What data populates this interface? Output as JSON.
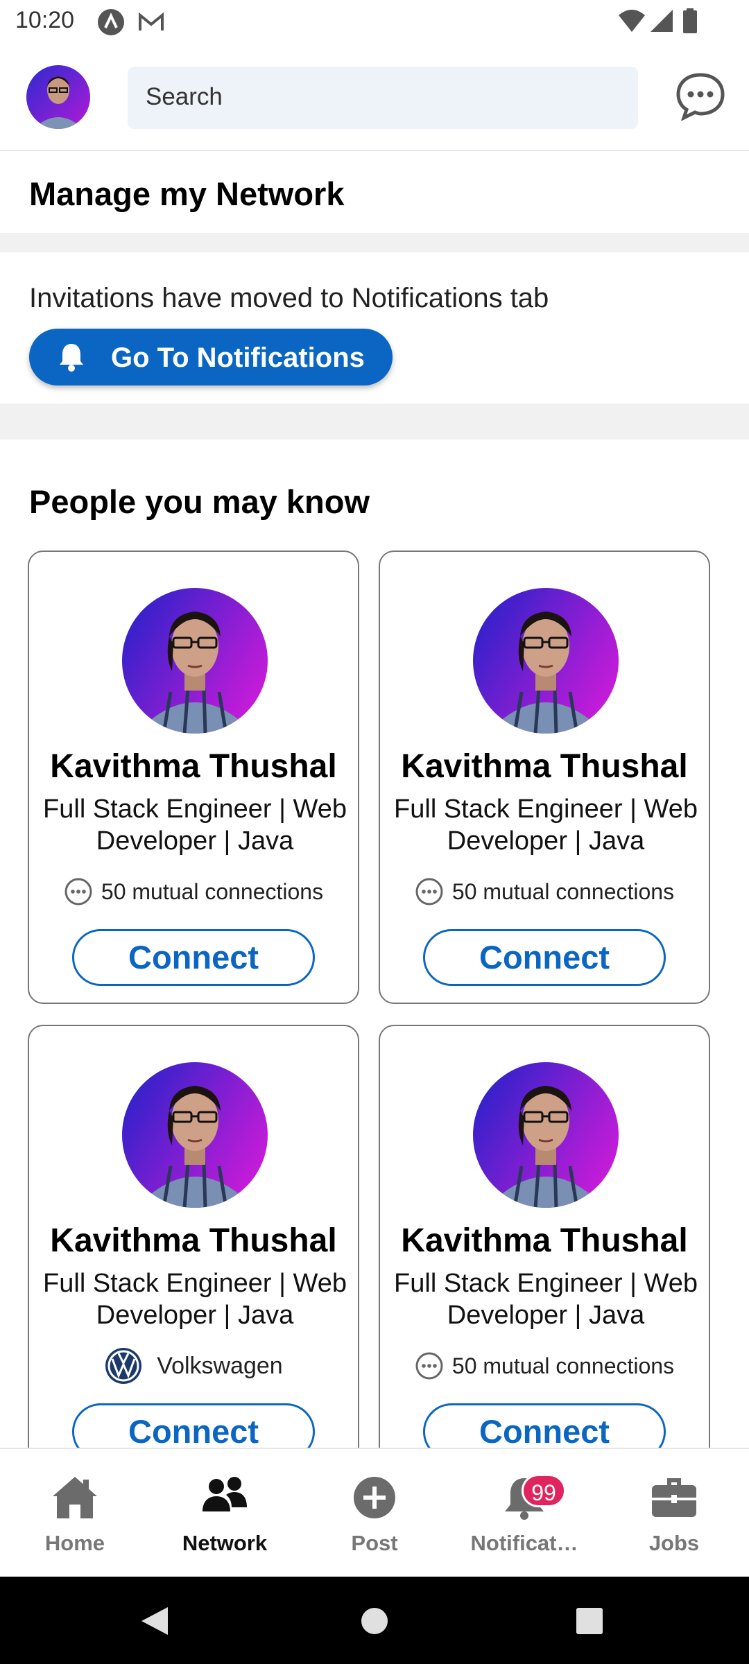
{
  "status_bar": {
    "time": "10:20"
  },
  "header": {
    "search_placeholder": "Search"
  },
  "manage": {
    "title": "Manage my Network"
  },
  "invitations": {
    "message": "Invitations have moved to Notifications tab",
    "button_label": "Go To Notifications"
  },
  "people": {
    "title": "People you may know",
    "cards": [
      {
        "name": "Kavithma Thushal",
        "headline": "Full Stack Engineer | Web Developer | Java",
        "meta": "50 mutual connections",
        "meta_icon": "mutual-connections-icon",
        "button": "Connect"
      },
      {
        "name": "Kavithma Thushal",
        "headline": "Full Stack Engineer | Web Developer | Java",
        "meta": "50 mutual connections",
        "meta_icon": "mutual-connections-icon",
        "button": "Connect"
      },
      {
        "name": "Kavithma Thushal",
        "headline": "Full Stack Engineer | Web Developer | Java",
        "meta": "Volkswagen",
        "meta_icon": "volkswagen-logo-icon",
        "button": "Connect"
      },
      {
        "name": "Kavithma Thushal",
        "headline": "Full Stack Engineer | Web Developer | Java",
        "meta": "50 mutual connections",
        "meta_icon": "mutual-connections-icon",
        "button": "Connect"
      }
    ]
  },
  "bottom_nav": {
    "items": [
      {
        "label": "Home",
        "icon": "home-icon"
      },
      {
        "label": "Network",
        "icon": "network-icon"
      },
      {
        "label": "Post",
        "icon": "post-icon"
      },
      {
        "label": "Notificat…",
        "icon": "bell-icon",
        "badge": "99"
      },
      {
        "label": "Jobs",
        "icon": "jobs-icon"
      }
    ],
    "active": "Network"
  },
  "colors": {
    "brand": "#0a66c2",
    "badge": "#e0245e"
  }
}
